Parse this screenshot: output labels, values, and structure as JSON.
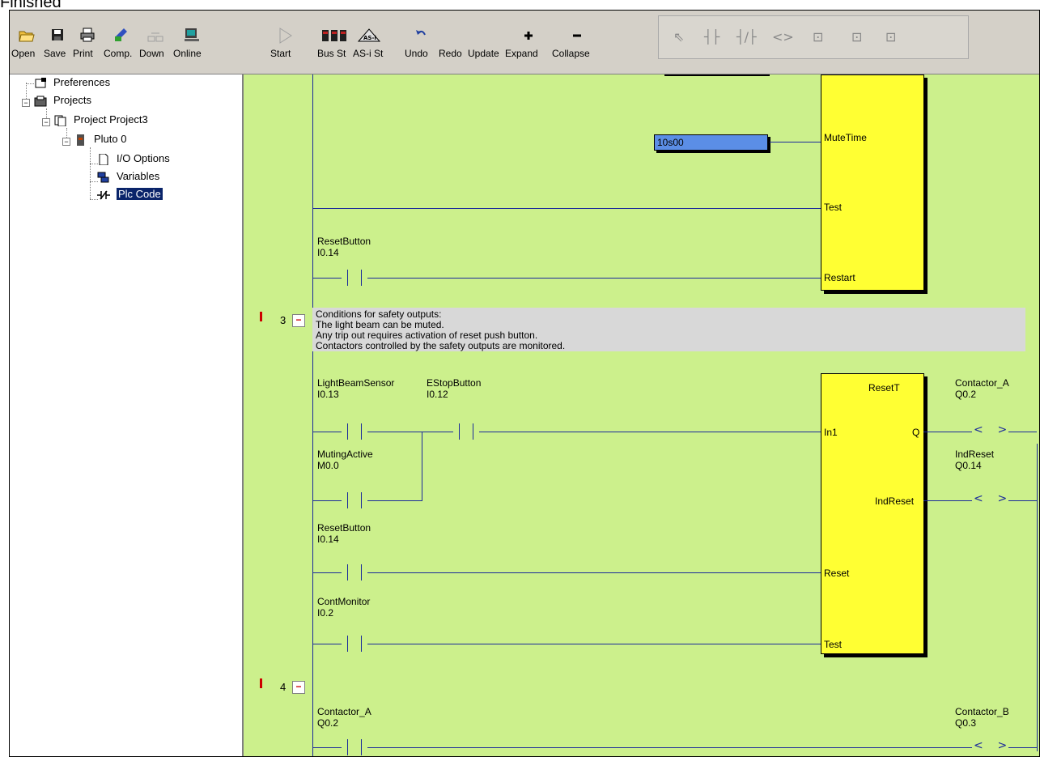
{
  "status_text": "Finished",
  "toolbar": {
    "buttons": [
      {
        "label": "Open",
        "icon": "open-folder-icon"
      },
      {
        "label": "Save",
        "icon": "floppy-icon"
      },
      {
        "label": "Print",
        "icon": "printer-icon"
      },
      {
        "label": "Comp.",
        "icon": "compile-icon"
      },
      {
        "label": "Down",
        "icon": "download-icon",
        "disabled": true
      },
      {
        "label": "Online",
        "icon": "online-icon"
      },
      {
        "label": "Start",
        "icon": "play-icon",
        "disabled": true
      },
      {
        "label": "Bus St",
        "icon": "bus-status-icon"
      },
      {
        "label": "AS-i St",
        "icon": "asi-status-icon"
      },
      {
        "label": "Undo",
        "icon": "undo-icon"
      },
      {
        "label": "Redo",
        "icon": "redo-icon",
        "disabled": true
      },
      {
        "label": "Update",
        "icon": "update-icon",
        "disabled": true
      },
      {
        "label": "Expand",
        "icon": "expand-icon"
      },
      {
        "label": "Collapse",
        "icon": "collapse-icon"
      }
    ]
  },
  "tree": {
    "items": [
      {
        "label": "Preferences",
        "icon": "preferences-icon"
      },
      {
        "label": "Projects",
        "icon": "projects-icon"
      },
      {
        "label": "Project Project3",
        "icon": "project-icon"
      },
      {
        "label": "Pluto 0",
        "icon": "plc-icon"
      },
      {
        "label": "I/O Options",
        "icon": "document-icon"
      },
      {
        "label": "Variables",
        "icon": "variables-icon"
      },
      {
        "label": "Plc Code",
        "icon": "ladder-icon"
      }
    ]
  },
  "ladder": {
    "mute_value": "10s00",
    "block1_pins": {
      "mutetime": "MuteTime",
      "test": "Test",
      "restart": "Restart"
    },
    "reset_button_top": {
      "name": "ResetButton",
      "addr": "I0.14"
    },
    "rung3": {
      "number": "3",
      "comment": [
        "Conditions for safety outputs:",
        "The light beam can be muted.",
        "Any trip out requires activation of reset push button.",
        "Contactors controlled by the safety outputs are monitored."
      ],
      "block_title": "ResetT",
      "pins": {
        "in1": "In1",
        "q": "Q",
        "indreset": "IndReset",
        "reset": "Reset",
        "test": "Test"
      },
      "contacts": {
        "lightbeam": {
          "name": "LightBeamSensor",
          "addr": "I0.13"
        },
        "estop": {
          "name": "EStopButton",
          "addr": "I0.12"
        },
        "muting": {
          "name": "MutingActive",
          "addr": "M0.0"
        },
        "reset": {
          "name": "ResetButton",
          "addr": "I0.14"
        },
        "contmon": {
          "name": "ContMonitor",
          "addr": "I0.2"
        }
      },
      "coils": {
        "contactor_a": {
          "name": "Contactor_A",
          "addr": "Q0.2"
        },
        "indreset": {
          "name": "IndReset",
          "addr": "Q0.14"
        }
      }
    },
    "rung4": {
      "number": "4",
      "contact": {
        "name": "Contactor_A",
        "addr": "Q0.2"
      },
      "coil": {
        "name": "Contactor_B",
        "addr": "Q0.3"
      }
    }
  }
}
